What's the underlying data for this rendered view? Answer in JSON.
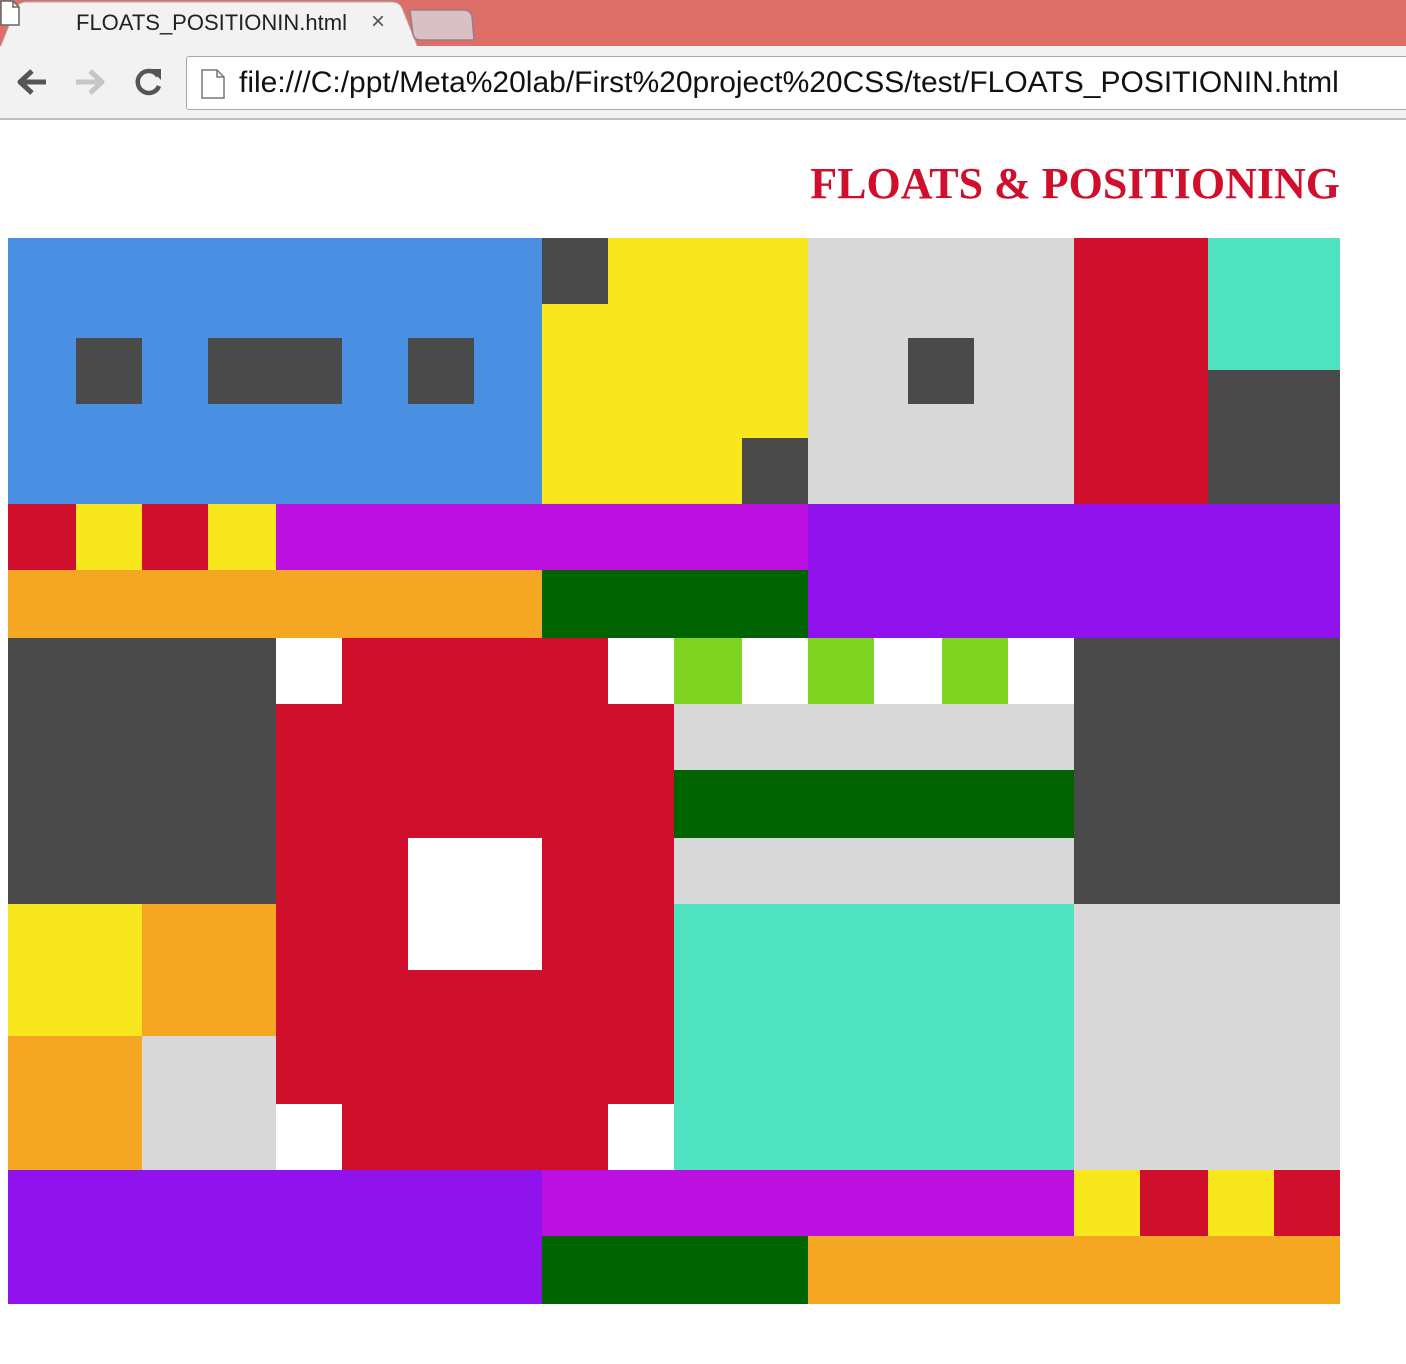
{
  "browser": {
    "tab_title": "FLOATS_POSITIONIN.html",
    "tab_close_glyph": "×",
    "url": "file:///C:/ppt/Meta%20lab/First%20project%20CSS/test/FLOATS_POSITIONIN.html",
    "icons": {
      "tab": "file-icon",
      "back": "arrow-left-icon",
      "forward": "arrow-right-icon",
      "reload": "reload-icon",
      "omnibox": "file-icon"
    },
    "colors": {
      "tabstrip": "#dd6e68",
      "toolbar": "#f2f2f2"
    }
  },
  "page": {
    "heading": "FLOATS & POSITIONING",
    "heading_color": "#cf0f2c",
    "palette": {
      "blue": "#4a90e2",
      "dark": "#4a4a4a",
      "yellow": "#f8e71c",
      "light": "#d8d8d8",
      "red": "#cf0f2c",
      "teal": "#50e3c2",
      "magenta": "#bc10e0",
      "purple": "#9013ee",
      "orange": "#f5a623",
      "green": "#006400",
      "lime": "#7ed321",
      "white": "#ffffff"
    }
  }
}
